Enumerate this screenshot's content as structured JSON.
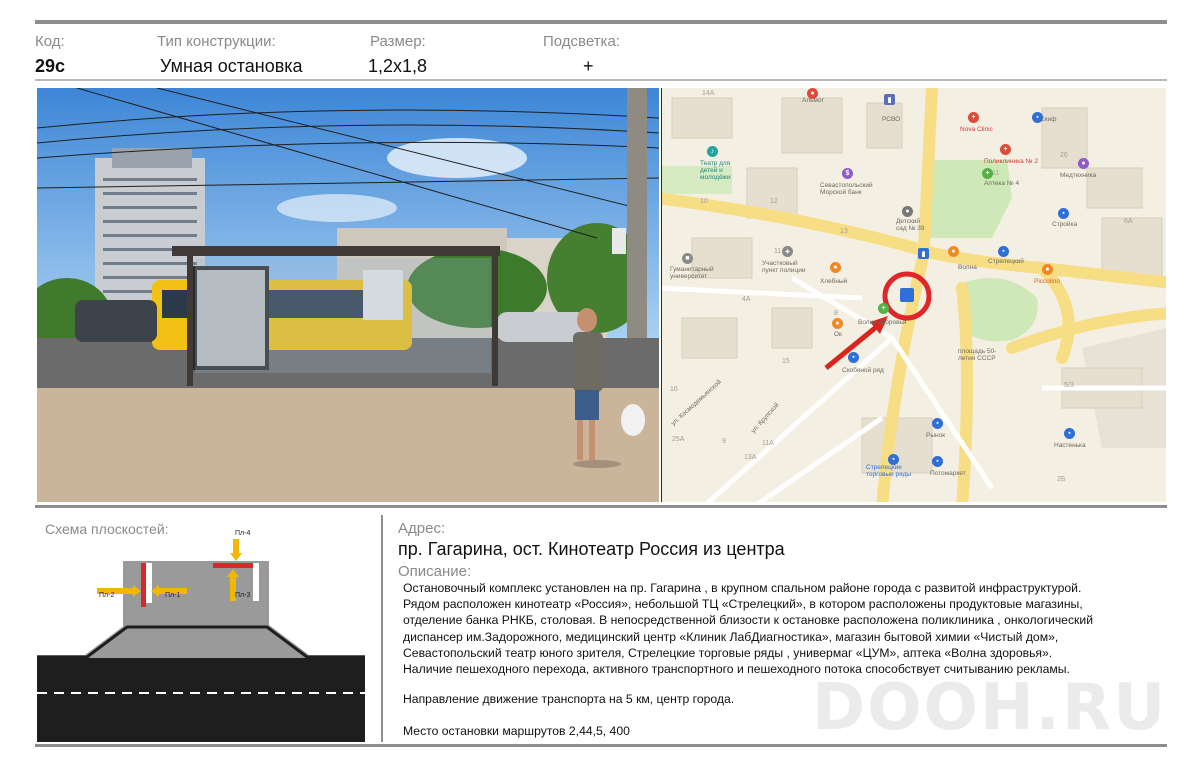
{
  "header": {
    "code_label": "Код:",
    "code_value": "29с",
    "type_label": "Тип конструкции:",
    "type_value": "Умная остановка",
    "size_label": "Размер:",
    "size_value": "1,2х1,8",
    "light_label": "Подсветка:",
    "light_value": "+"
  },
  "map": {
    "house_numbers": [
      "14А",
      "12",
      "10",
      "11",
      "13",
      "11",
      "6А",
      "26",
      "4А",
      "15",
      "16",
      "13А",
      "11А",
      "8",
      "5/3",
      "25А",
      "9",
      "2Б"
    ],
    "labels": {
      "almog": "Альмог",
      "rsvo": "РСВО",
      "nova_clinic": "Nova Clinic",
      "skif": "Скиф",
      "theatre": "Театр для\nдетей и\nмолодёжи",
      "poliklinika": "Поликлиника № 2",
      "apteka": "Аптека № 4",
      "medtechnika": "Медтехника",
      "morskoy_bank": "Севастопольский\nМорской банк",
      "detsad": "Детский\nсад № 39",
      "stroyka": "Стройка",
      "police": "Участковый\nпункт полиции",
      "university": "Гуманитарный\nуниверситет",
      "hlebny": "Хлебный",
      "volna": "Волна",
      "streletsky": "Стрелецкий",
      "piccolino": "Piccolino",
      "ok": "Ок",
      "volna_zdorovya": "Волна здоровья",
      "skobyanoy": "Скобяной ряд",
      "square": "площадь 50-\nлетия СССР",
      "kosmodemyanskoy": "ул. Космодемьянской",
      "krupskoy": "ул. Крупской",
      "rynok": "Рынок",
      "nastenka": "Настенька",
      "torgovye_ryady": "Стрелецкие\nторговые ряды",
      "potomarket": "Потомаркет"
    }
  },
  "scheme": {
    "title": "Схема плоскостей:",
    "planes": [
      "Пл-4",
      "Пл-2",
      "Пл-1",
      "Пл-3"
    ]
  },
  "address": {
    "label": "Адрес:",
    "value": "пр. Гагарина, ост. Кинотеатр Россия из центра"
  },
  "description": {
    "label": "Описание:",
    "lines": [
      "Остановочный комплекс установлен на пр. Гагарина , в крупном спальном районе города  с развитой инфраструктурой.",
      "Рядом расположен  кинотеатр «Россия», небольшой  ТЦ «Стрелецкий», в котором расположены продуктовые магазины,",
      "отделение банка РНКБ, столовая. В непосредственной близости к остановке расположена поликлиника , онкологический",
      "диспансер им.Задорожного, медицинский центр «Клиник ЛабДиагностика», магазин бытовой химии «Чистый дом»,",
      "Севастопольский театр юного зрителя,  Стрелецкие торговые ряды , универмаг «ЦУМ», аптека «Волна здоровья».",
      "Наличие пешеходного перехода, активного транспортного и пешеходного потока способствует    считыванию рекламы."
    ],
    "direction": "Направление движение транспорта на 5 км, центр города.",
    "stops": "Место остановки маршрутов 2,44,5, 400"
  },
  "watermark": "DOOH.RU",
  "colors": {
    "marker_red": "#e0262b",
    "plane_red": "#d62a2a",
    "arrow_yellow": "#f2b705",
    "road": "#1e1e1e",
    "sidewalk": "#9a9a9a",
    "map_bg": "#f4efe3"
  }
}
